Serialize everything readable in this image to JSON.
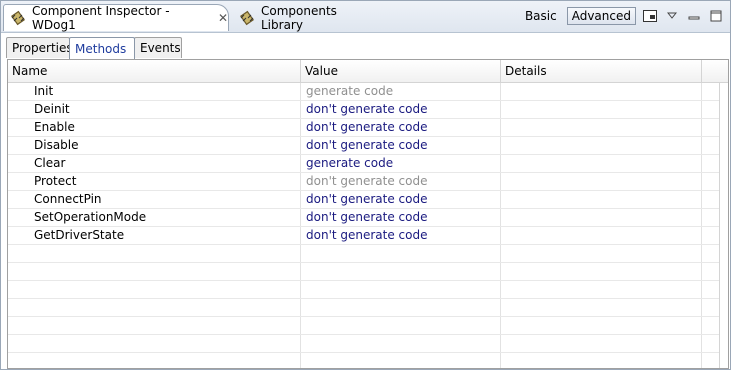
{
  "view_tabs": {
    "inspector": {
      "label": "Component Inspector - WDog1",
      "icon": "component-icon"
    },
    "library": {
      "label": "Components Library",
      "icon": "library-icon"
    }
  },
  "toolbar": {
    "basic_label": "Basic",
    "advanced_label": "Advanced"
  },
  "sub_tabs": {
    "properties": "Properties",
    "methods": "Methods",
    "events": "Events"
  },
  "table": {
    "headers": {
      "name": "Name",
      "value": "Value",
      "details": "Details"
    },
    "rows": [
      {
        "name": "Init",
        "value": "generate code",
        "state": "disabled"
      },
      {
        "name": "Deinit",
        "value": "don't generate code",
        "state": "active"
      },
      {
        "name": "Enable",
        "value": "don't generate code",
        "state": "active"
      },
      {
        "name": "Disable",
        "value": "don't generate code",
        "state": "active"
      },
      {
        "name": "Clear",
        "value": "generate code",
        "state": "active"
      },
      {
        "name": "Protect",
        "value": "don't generate code",
        "state": "disabled"
      },
      {
        "name": "ConnectPin",
        "value": "don't generate code",
        "state": "active"
      },
      {
        "name": "SetOperationMode",
        "value": "don't generate code",
        "state": "active"
      },
      {
        "name": "GetDriverState",
        "value": "don't generate code",
        "state": "active"
      }
    ],
    "empty_rows": 7
  },
  "colors": {
    "value_active": "#1a1a80",
    "value_disabled": "#909090",
    "selected_tab_text": "#1f3c9e"
  }
}
